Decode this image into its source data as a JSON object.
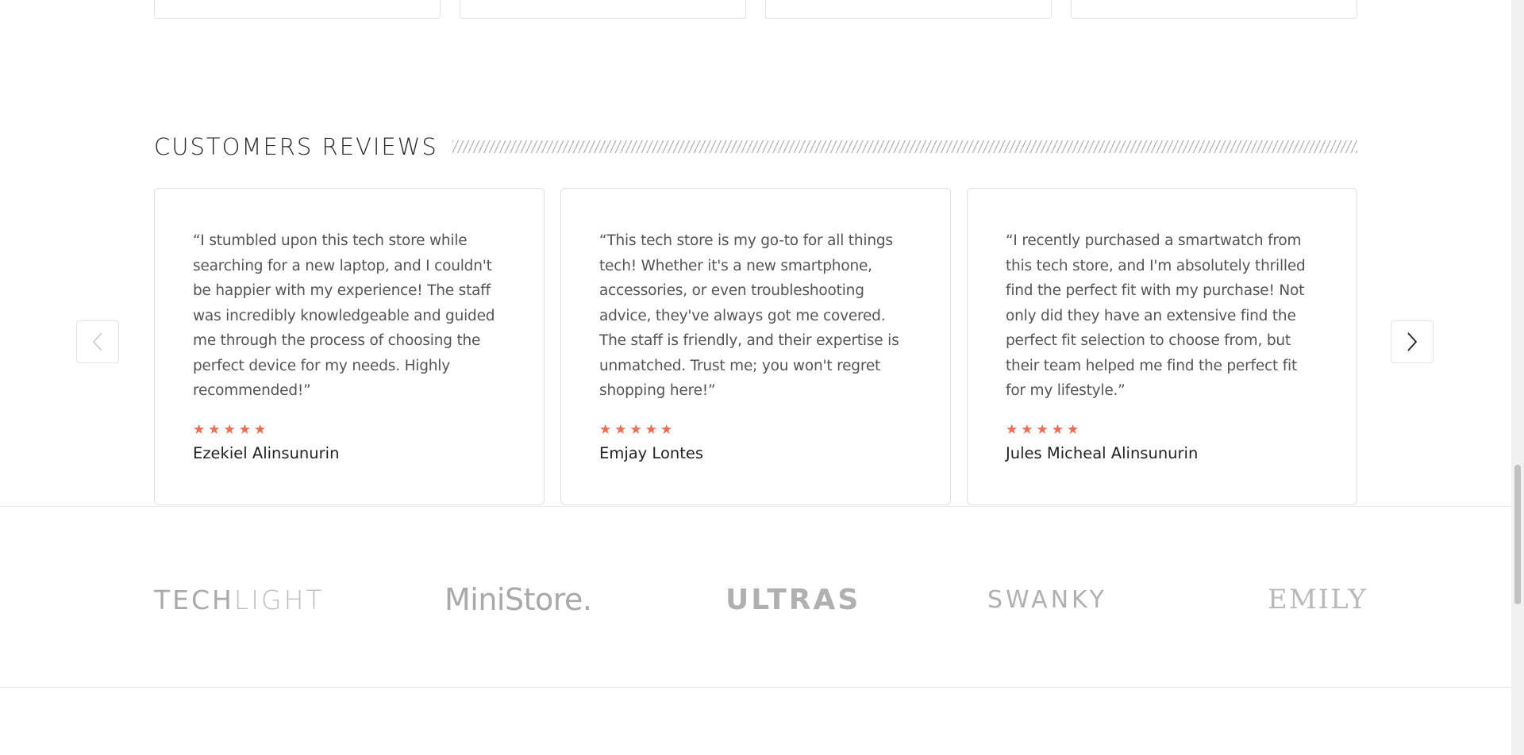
{
  "reviews_section": {
    "title": "CUSTOMERS REVIEWS",
    "prev_icon": "chevron-left-icon",
    "next_icon": "chevron-right-icon",
    "star_color": "#f26b4f",
    "reviews": [
      {
        "text": "“I stumbled upon this tech store while searching for a new laptop, and I couldn't be happier with my experience! The staff was incredibly knowledgeable and guided me through the process of choosing the perfect device for my needs. Highly recommended!”",
        "rating": 5,
        "author": "Ezekiel Alinsunurin"
      },
      {
        "text": "“This tech store is my go-to for all things tech! Whether it's a new smartphone, accessories, or even troubleshooting advice, they've always got me covered. The staff is friendly, and their expertise is unmatched. Trust me; you won't regret shopping here!”",
        "rating": 5,
        "author": "Emjay Lontes"
      },
      {
        "text": "“I recently purchased a smartwatch from this tech store, and I'm absolutely thrilled find the perfect fit with my purchase! Not only did they have an extensive find the perfect fit selection to choose from, but their team helped me find the perfect fit for my lifestyle.”",
        "rating": 5,
        "author": "Jules Micheal Alinsunurin"
      }
    ]
  },
  "brands": {
    "techlight_a": "TECH",
    "techlight_b": "LIGHT",
    "ministore": "MiniStore.",
    "ultras": "ULTRAS",
    "swanky": "SWANKY",
    "emily": "EMILY"
  }
}
